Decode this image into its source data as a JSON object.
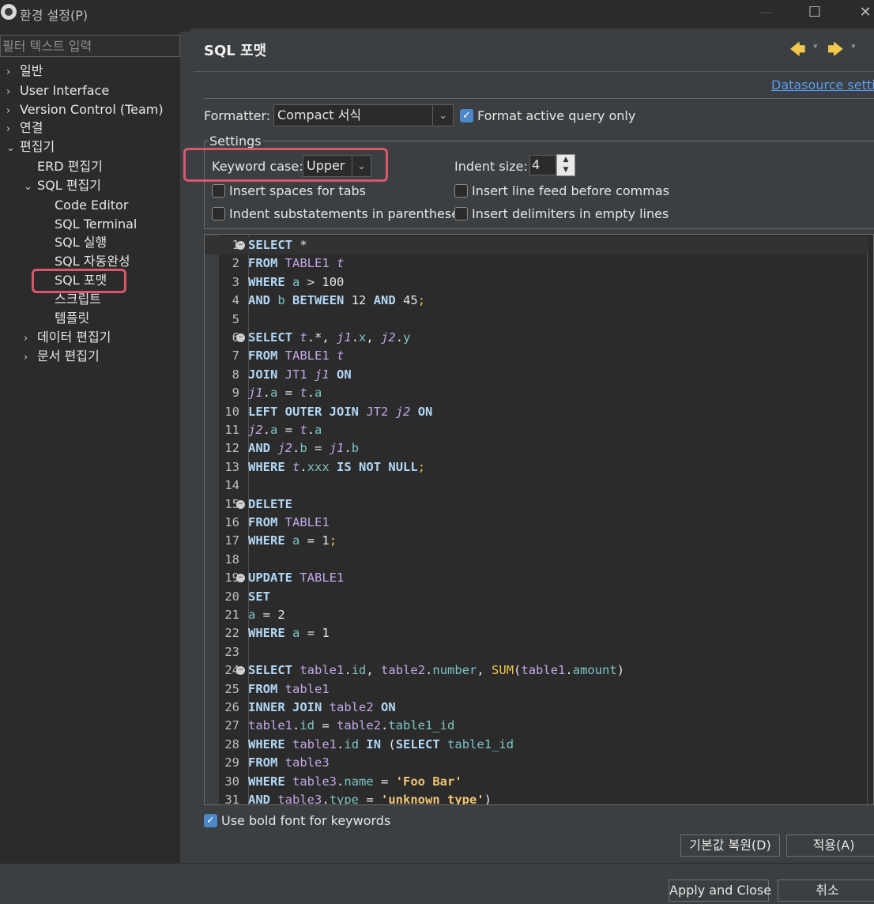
{
  "window": {
    "title": "환경 설정(P)",
    "minimize": "—",
    "maximize": "☐",
    "close": "✕"
  },
  "sidebar": {
    "filter_placeholder": "필터 텍스트 입력",
    "items": [
      {
        "label": "일반",
        "chevron": "›"
      },
      {
        "label": "User Interface",
        "chevron": "›"
      },
      {
        "label": "Version Control (Team)",
        "chevron": "›"
      },
      {
        "label": "연결",
        "chevron": "›"
      },
      {
        "label": "편집기",
        "chevron": "⌄"
      },
      {
        "label": "ERD 편집기"
      },
      {
        "label": "SQL 편집기",
        "chevron": "⌄"
      },
      {
        "label": "Code Editor"
      },
      {
        "label": "SQL Terminal"
      },
      {
        "label": "SQL 실행"
      },
      {
        "label": "SQL 자동완성"
      },
      {
        "label": "SQL 포맷"
      },
      {
        "label": "스크립트"
      },
      {
        "label": "템플릿"
      },
      {
        "label": "데이터 편집기",
        "chevron": "›"
      },
      {
        "label": "문서 편집기",
        "chevron": "›"
      }
    ]
  },
  "header": {
    "title": "SQL 포맷",
    "back_arrow": "🡄",
    "forward_arrow": "🡆",
    "dropdown_caret": "▾",
    "datasource_link": "Datasource settings"
  },
  "formatter": {
    "label": "Formatter:",
    "value": "Compact 서식",
    "caret": "⌄",
    "active_query_only_label": "Format active query only",
    "active_query_only_checked": true
  },
  "settings": {
    "group_title": "Settings",
    "keyword_case_label": "Keyword case:",
    "keyword_case_value": "Upper",
    "indent_size_label": "Indent size:",
    "indent_size_value": "4",
    "insert_spaces_label": "Insert spaces for tabs",
    "indent_substatements_label": "Indent substatements in parentheses",
    "line_feed_commas_label": "Insert line feed before commas",
    "delimiters_empty_label": "Insert delimiters in empty lines"
  },
  "editor": {
    "lines": [
      {
        "n": "1",
        "fold": true,
        "tokens": [
          [
            "kw",
            "SELECT"
          ],
          [
            "op",
            " *"
          ]
        ]
      },
      {
        "n": "2",
        "tokens": [
          [
            "kw",
            "FROM"
          ],
          [
            "op",
            " "
          ],
          [
            "tb",
            "TABLE1"
          ],
          [
            "op",
            " "
          ],
          [
            "al",
            "t"
          ]
        ]
      },
      {
        "n": "3",
        "tokens": [
          [
            "kw",
            "WHERE"
          ],
          [
            "op",
            " "
          ],
          [
            "col",
            "a"
          ],
          [
            "op",
            " > "
          ],
          [
            "num",
            "100"
          ]
        ]
      },
      {
        "n": "4",
        "tokens": [
          [
            "kw",
            "AND"
          ],
          [
            "op",
            " "
          ],
          [
            "col",
            "b"
          ],
          [
            "op",
            " "
          ],
          [
            "kw",
            "BETWEEN"
          ],
          [
            "op",
            " "
          ],
          [
            "num",
            "12"
          ],
          [
            "op",
            " "
          ],
          [
            "kw",
            "AND"
          ],
          [
            "op",
            " "
          ],
          [
            "num",
            "45"
          ],
          [
            "sc",
            ";"
          ]
        ]
      },
      {
        "n": "5",
        "tokens": []
      },
      {
        "n": "6",
        "fold": true,
        "tokens": [
          [
            "kw",
            "SELECT"
          ],
          [
            "op",
            " "
          ],
          [
            "al",
            "t"
          ],
          [
            "op",
            ".*, "
          ],
          [
            "al",
            "j1"
          ],
          [
            "op",
            "."
          ],
          [
            "col",
            "x"
          ],
          [
            "op",
            ", "
          ],
          [
            "al",
            "j2"
          ],
          [
            "op",
            "."
          ],
          [
            "col",
            "y"
          ]
        ]
      },
      {
        "n": "7",
        "tokens": [
          [
            "kw",
            "FROM"
          ],
          [
            "op",
            " "
          ],
          [
            "tb",
            "TABLE1"
          ],
          [
            "op",
            " "
          ],
          [
            "al",
            "t"
          ]
        ]
      },
      {
        "n": "8",
        "tokens": [
          [
            "kw",
            "JOIN"
          ],
          [
            "op",
            " "
          ],
          [
            "tb",
            "JT1"
          ],
          [
            "op",
            " "
          ],
          [
            "al",
            "j1"
          ],
          [
            "op",
            " "
          ],
          [
            "kw",
            "ON"
          ]
        ]
      },
      {
        "n": "9",
        "tokens": [
          [
            "al",
            "j1"
          ],
          [
            "op",
            "."
          ],
          [
            "col",
            "a"
          ],
          [
            "op",
            " = "
          ],
          [
            "al",
            "t"
          ],
          [
            "op",
            "."
          ],
          [
            "col",
            "a"
          ]
        ]
      },
      {
        "n": "10",
        "tokens": [
          [
            "kw",
            "LEFT OUTER JOIN"
          ],
          [
            "op",
            " "
          ],
          [
            "tb",
            "JT2"
          ],
          [
            "op",
            " "
          ],
          [
            "al",
            "j2"
          ],
          [
            "op",
            " "
          ],
          [
            "kw",
            "ON"
          ]
        ]
      },
      {
        "n": "11",
        "tokens": [
          [
            "al",
            "j2"
          ],
          [
            "op",
            "."
          ],
          [
            "col",
            "a"
          ],
          [
            "op",
            " = "
          ],
          [
            "al",
            "t"
          ],
          [
            "op",
            "."
          ],
          [
            "col",
            "a"
          ]
        ]
      },
      {
        "n": "12",
        "tokens": [
          [
            "kw",
            "AND"
          ],
          [
            "op",
            " "
          ],
          [
            "al",
            "j2"
          ],
          [
            "op",
            "."
          ],
          [
            "col",
            "b"
          ],
          [
            "op",
            " = "
          ],
          [
            "al",
            "j1"
          ],
          [
            "op",
            "."
          ],
          [
            "col",
            "b"
          ]
        ]
      },
      {
        "n": "13",
        "tokens": [
          [
            "kw",
            "WHERE"
          ],
          [
            "op",
            " "
          ],
          [
            "al",
            "t"
          ],
          [
            "op",
            "."
          ],
          [
            "col",
            "xxx"
          ],
          [
            "op",
            " "
          ],
          [
            "kw",
            "IS NOT NULL"
          ],
          [
            "sc",
            ";"
          ]
        ]
      },
      {
        "n": "14",
        "tokens": []
      },
      {
        "n": "15",
        "fold": true,
        "tokens": [
          [
            "kw",
            "DELETE"
          ]
        ]
      },
      {
        "n": "16",
        "tokens": [
          [
            "kw",
            "FROM"
          ],
          [
            "op",
            " "
          ],
          [
            "tb",
            "TABLE1"
          ]
        ]
      },
      {
        "n": "17",
        "tokens": [
          [
            "kw",
            "WHERE"
          ],
          [
            "op",
            " "
          ],
          [
            "col",
            "a"
          ],
          [
            "op",
            " = "
          ],
          [
            "num",
            "1"
          ],
          [
            "sc",
            ";"
          ]
        ]
      },
      {
        "n": "18",
        "tokens": []
      },
      {
        "n": "19",
        "fold": true,
        "tokens": [
          [
            "kw",
            "UPDATE"
          ],
          [
            "op",
            " "
          ],
          [
            "tb",
            "TABLE1"
          ]
        ]
      },
      {
        "n": "20",
        "tokens": [
          [
            "kw",
            "SET"
          ]
        ]
      },
      {
        "n": "21",
        "tokens": [
          [
            "col",
            "a"
          ],
          [
            "op",
            " = "
          ],
          [
            "num",
            "2"
          ]
        ]
      },
      {
        "n": "22",
        "tokens": [
          [
            "kw",
            "WHERE"
          ],
          [
            "op",
            " "
          ],
          [
            "col",
            "a"
          ],
          [
            "op",
            " = "
          ],
          [
            "num",
            "1"
          ]
        ]
      },
      {
        "n": "23",
        "tokens": []
      },
      {
        "n": "24",
        "fold": true,
        "tokens": [
          [
            "kw",
            "SELECT"
          ],
          [
            "op",
            " "
          ],
          [
            "tb",
            "table1"
          ],
          [
            "op",
            "."
          ],
          [
            "col",
            "id"
          ],
          [
            "op",
            ", "
          ],
          [
            "tb",
            "table2"
          ],
          [
            "op",
            "."
          ],
          [
            "col",
            "number"
          ],
          [
            "op",
            ", "
          ],
          [
            "fn",
            "SUM"
          ],
          [
            "op",
            "("
          ],
          [
            "tb",
            "table1"
          ],
          [
            "op",
            "."
          ],
          [
            "col",
            "amount"
          ],
          [
            "op",
            ")"
          ]
        ]
      },
      {
        "n": "25",
        "tokens": [
          [
            "kw",
            "FROM"
          ],
          [
            "op",
            " "
          ],
          [
            "tb",
            "table1"
          ]
        ]
      },
      {
        "n": "26",
        "tokens": [
          [
            "kw",
            "INNER JOIN"
          ],
          [
            "op",
            " "
          ],
          [
            "tb",
            "table2"
          ],
          [
            "op",
            " "
          ],
          [
            "kw",
            "ON"
          ]
        ]
      },
      {
        "n": "27",
        "tokens": [
          [
            "tb",
            "table1"
          ],
          [
            "op",
            "."
          ],
          [
            "col",
            "id"
          ],
          [
            "op",
            " = "
          ],
          [
            "tb",
            "table2"
          ],
          [
            "op",
            "."
          ],
          [
            "col",
            "table1_id"
          ]
        ]
      },
      {
        "n": "28",
        "tokens": [
          [
            "kw",
            "WHERE"
          ],
          [
            "op",
            " "
          ],
          [
            "tb",
            "table1"
          ],
          [
            "op",
            "."
          ],
          [
            "col",
            "id"
          ],
          [
            "op",
            " "
          ],
          [
            "kw",
            "IN"
          ],
          [
            "op",
            " ("
          ],
          [
            "kw",
            "SELECT"
          ],
          [
            "op",
            " "
          ],
          [
            "col",
            "table1_id"
          ]
        ]
      },
      {
        "n": "29",
        "tokens": [
          [
            "kw",
            "FROM"
          ],
          [
            "op",
            " "
          ],
          [
            "tb",
            "table3"
          ]
        ]
      },
      {
        "n": "30",
        "tokens": [
          [
            "kw",
            "WHERE"
          ],
          [
            "op",
            " "
          ],
          [
            "tb",
            "table3"
          ],
          [
            "op",
            "."
          ],
          [
            "col",
            "name"
          ],
          [
            "op",
            " = "
          ],
          [
            "str",
            "'Foo Bar'"
          ]
        ]
      },
      {
        "n": "31",
        "tokens": [
          [
            "kw",
            "AND"
          ],
          [
            "op",
            " "
          ],
          [
            "tb",
            "table3"
          ],
          [
            "op",
            "."
          ],
          [
            "col",
            "type"
          ],
          [
            "op",
            " = "
          ],
          [
            "str",
            "'unknown_type'"
          ],
          [
            "op",
            ")"
          ]
        ]
      }
    ]
  },
  "bold_keywords": {
    "label": "Use bold font for keywords",
    "checked": true
  },
  "buttons": {
    "restore_defaults": "기본값 복원(D)",
    "apply": "적용(A)",
    "apply_and_close": "Apply and Close",
    "cancel": "취소"
  },
  "colors": {
    "highlight": "#d9566b",
    "link": "#589df6",
    "keyword": "#b2d7f6",
    "table": "#c3a6e6",
    "column": "#7ec3c3",
    "string": "#f0c674"
  }
}
